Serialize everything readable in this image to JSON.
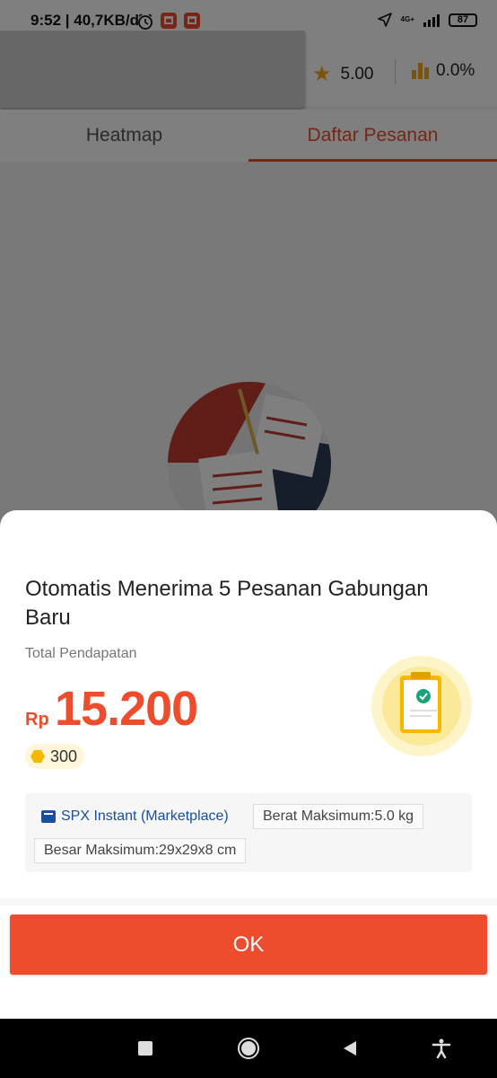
{
  "status_bar": {
    "time": "9:52",
    "speed": "40,7KB/d",
    "network": "4G+",
    "battery": "87"
  },
  "header": {
    "rating": "5.00",
    "percentage": "0.0%"
  },
  "tabs": [
    {
      "label": "Heatmap",
      "active": false
    },
    {
      "label": "Daftar Pesanan",
      "active": true
    }
  ],
  "sheet": {
    "title": "Otomatis Menerima 5 Pesanan Gabungan Baru",
    "income_label": "Total Pendapatan",
    "currency": "Rp",
    "amount": "15.200",
    "coins": "300",
    "service": "SPX Instant (Marketplace)",
    "max_weight": "Berat Maksimum:5.0 kg",
    "max_size": "Besar Maksimum:29x29x8 cm",
    "ok_label": "OK"
  },
  "colors": {
    "accent": "#ee4d2d",
    "star": "#f5a623",
    "service_blue": "#1a4fa0"
  },
  "icons": [
    "alarm-icon",
    "location-icon",
    "signal-icon",
    "battery-icon",
    "star-icon",
    "bar-chart-icon",
    "coin-icon",
    "truck-icon",
    "clipboard-check-icon",
    "square-icon",
    "circle-icon",
    "back-triangle-icon",
    "accessibility-icon"
  ]
}
